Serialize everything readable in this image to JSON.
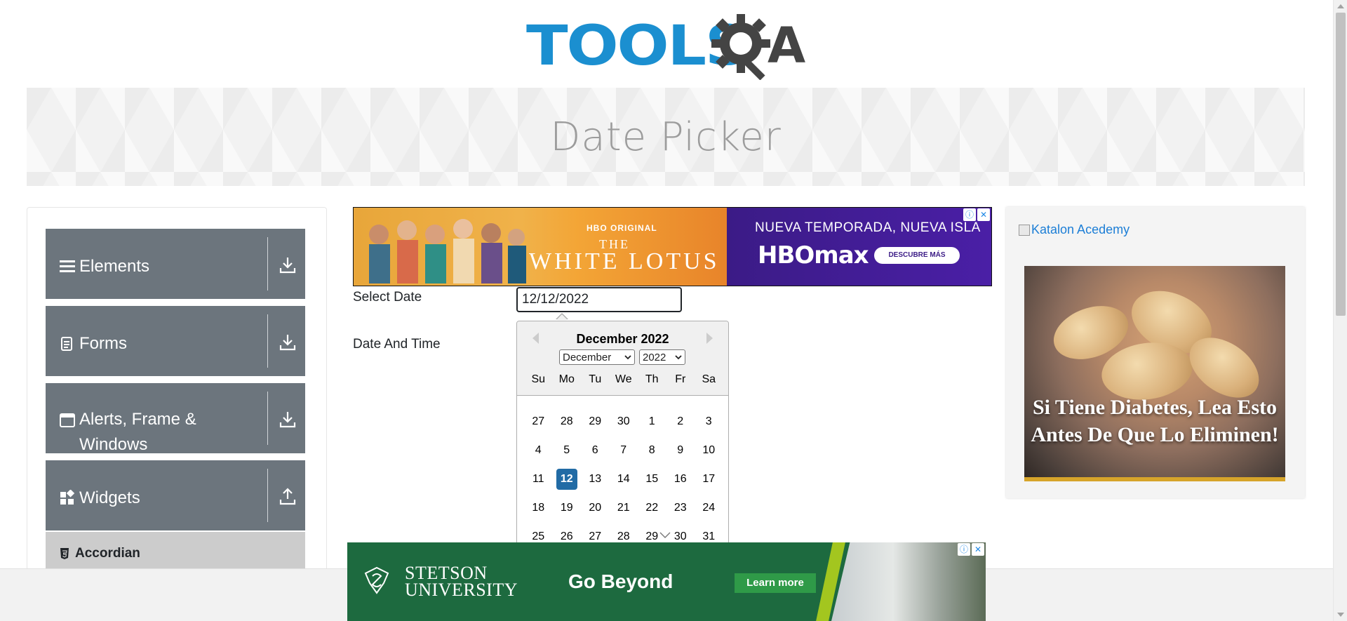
{
  "logo": {
    "text": "TOOLS",
    "suffix": "A"
  },
  "banner": {
    "title": "Date Picker"
  },
  "sidebar": {
    "groups": [
      {
        "label": "Elements",
        "icon": "hamburger-icon",
        "toggle": "download-icon"
      },
      {
        "label": "Forms",
        "icon": "document-icon",
        "toggle": "download-icon"
      },
      {
        "label": "Alerts, Frame & Windows",
        "icon": "window-icon",
        "toggle": "download-icon"
      },
      {
        "label": "Widgets",
        "icon": "widgets-icon",
        "toggle": "upload-icon"
      }
    ],
    "active_item": {
      "label": "Accordian",
      "icon": "html5-icon"
    }
  },
  "ad_top": {
    "hbo_original": "HBO ORIGINAL",
    "the": "THE",
    "title": "WHITE LOTUS",
    "tagline": "NUEVA TEMPORADA, NUEVA ISLA",
    "brand": "HBOmax",
    "cta": "DESCUBRE MÁS"
  },
  "form": {
    "select_date_label": "Select Date",
    "select_date_value": "12/12/2022",
    "date_time_label": "Date And Time"
  },
  "datepicker": {
    "title": "December 2022",
    "month_select": "December",
    "year_select": "2022",
    "weekdays": [
      "Su",
      "Mo",
      "Tu",
      "We",
      "Th",
      "Fr",
      "Sa"
    ],
    "weeks": [
      [
        "27",
        "28",
        "29",
        "30",
        "1",
        "2",
        "3"
      ],
      [
        "4",
        "5",
        "6",
        "7",
        "8",
        "9",
        "10"
      ],
      [
        "11",
        "12",
        "13",
        "14",
        "15",
        "16",
        "17"
      ],
      [
        "18",
        "19",
        "20",
        "21",
        "22",
        "23",
        "24"
      ],
      [
        "25",
        "26",
        "27",
        "28",
        "29",
        "30",
        "31"
      ]
    ],
    "selected_day": "12"
  },
  "ad_right": {
    "link_text": "Katalon Acedemy",
    "headline": "Si Tiene Diabetes, Lea Esto Antes De Que Lo Eliminen!"
  },
  "ad_bottom": {
    "brand_line1": "STETSON",
    "brand_line2": "UNIVERSITY",
    "slogan": "Go Beyond",
    "cta": "Learn more"
  },
  "colors": {
    "brand_blue": "#1b8fd0",
    "sidebar_group": "#6c757d",
    "selected_day": "#216ba5",
    "stetson_green": "#1d6a3f"
  }
}
